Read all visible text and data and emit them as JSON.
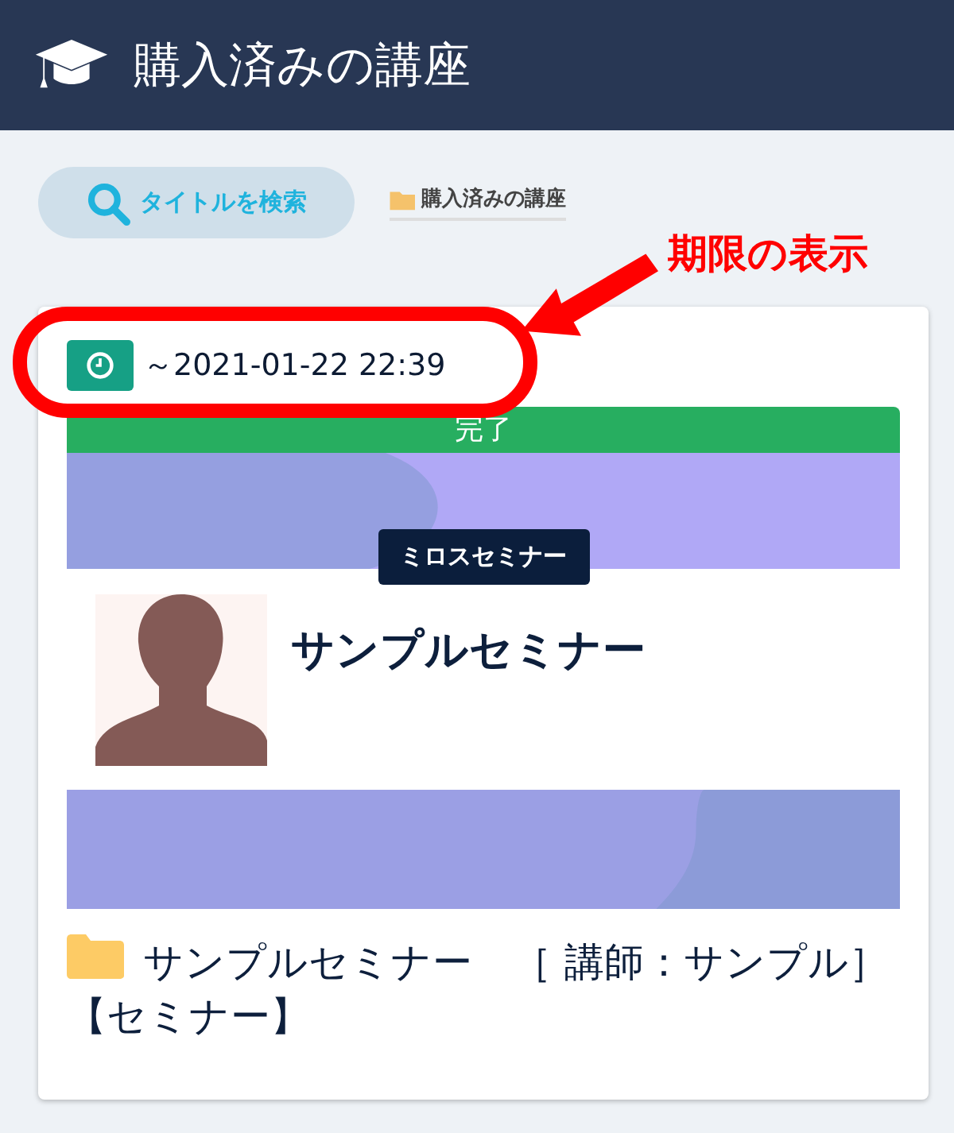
{
  "header": {
    "title": "購入済みの講座"
  },
  "toolbar": {
    "search_button": "タイトルを検索",
    "breadcrumb": "購入済みの講座"
  },
  "annotation": {
    "label": "期限の表示"
  },
  "course_card": {
    "deadline": "～2021-01-22 22:39",
    "status": {
      "label": "完了",
      "kind": "complete"
    },
    "organizer": "ミロスセミナー",
    "title": "サンプルセミナー",
    "footer_title": "サンプルセミナー　［ 講師：サンプル］【セミナー】"
  }
}
